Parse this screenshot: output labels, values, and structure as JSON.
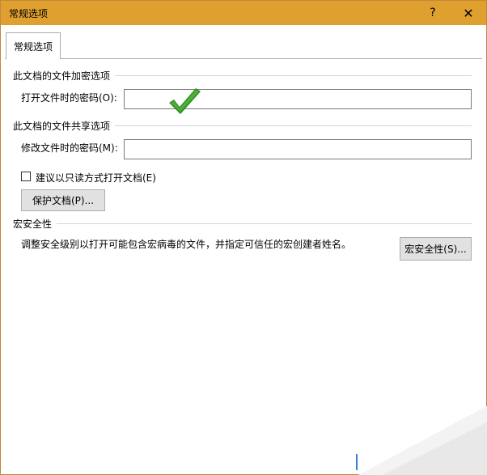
{
  "window": {
    "title": "常规选项",
    "help_label": "?",
    "close_label": "✕"
  },
  "tabs": [
    {
      "label": "常规选项"
    }
  ],
  "encryption": {
    "header": "此文档的文件加密选项",
    "open_password_label": "打开文件时的密码(O):",
    "open_password_value": ""
  },
  "sharing": {
    "header": "此文档的文件共享选项",
    "modify_password_label": "修改文件时的密码(M):",
    "modify_password_value": "",
    "read_only_label": "建议以只读方式打开文档(E)",
    "read_only_checked": false,
    "protect_button_label": "保护文档(P)..."
  },
  "macro": {
    "header": "宏安全性",
    "description": "调整安全级别以打开可能包含宏病毒的文件，并指定可信任的宏创建者姓名。",
    "button_label": "宏安全性(S)..."
  },
  "overlay": {
    "check_icon": "green-checkmark-icon",
    "check_color": "#3a9a2a",
    "title_bar_color": "#dfa030"
  }
}
